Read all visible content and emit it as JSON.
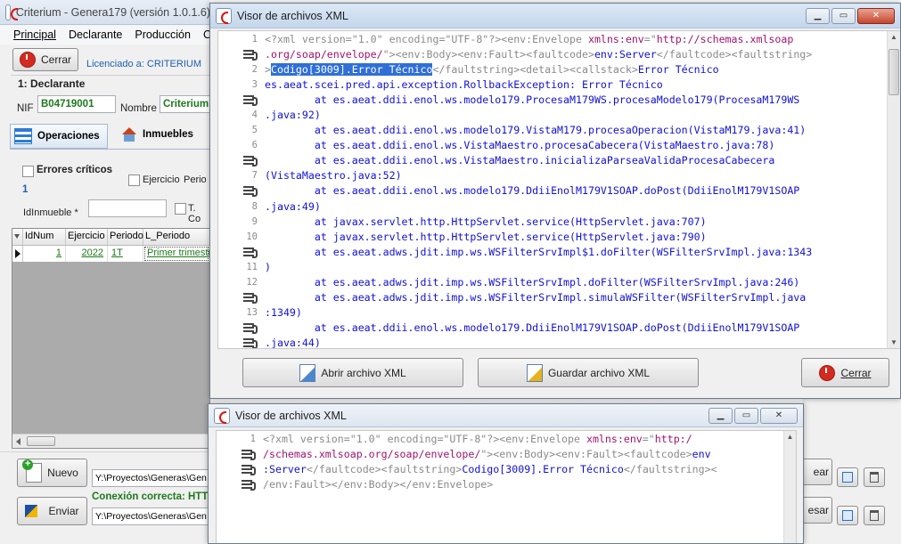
{
  "main_window": {
    "title": "Criterium - Genera179 (versión 1.0.1.6)",
    "menu": [
      "Principal",
      "Declarante",
      "Producción",
      "C"
    ],
    "cerrar_label": "Cerrar",
    "license": "Licenciado a: CRITERIUM",
    "section_title": "1: Declarante",
    "nif_label": "NIF",
    "nif_value": "B04719001",
    "nombre_label": "Nombre",
    "nombre_value": "Criterium",
    "tabs": [
      "Operaciones",
      "Inmuebles"
    ],
    "errores_label": "Errores críticos",
    "errores_count": "1",
    "ejercicio_label": "Ejercicio",
    "periodo_label": "Perio",
    "idinmueble_label": "IdInmueble *",
    "tc_label": "T. Co",
    "grid": {
      "headers": [
        "IdNum",
        "Ejercicio",
        "Periodo",
        "L_Periodo"
      ],
      "rows": [
        {
          "idnum": "1",
          "ejercicio": "2022",
          "periodo": "1T",
          "l_periodo": "Primer trimestr"
        }
      ]
    },
    "nuevo_label": "Nuevo",
    "path1": "Y:\\Proyectos\\Generas\\Gen",
    "conexion": "Conexión correcta: HTT",
    "enviar_label": "Enviar",
    "path2": "Y:\\Proyectos\\Generas\\Gen",
    "right_btn1": "ear",
    "right_btn2": "esar"
  },
  "xml_window_1": {
    "title": "Visor de archivos XML",
    "gutter": [
      "1",
      "",
      "2",
      "3",
      "",
      "4",
      "5",
      "6",
      "",
      "7",
      "",
      "8",
      "9",
      "10",
      "",
      "11",
      "12",
      "",
      "13",
      ""
    ],
    "lines": [
      [
        [
          "tg",
          "<?xml version=\"1.0\" encoding=\"UTF-8\"?><env:Envelope "
        ],
        [
          "kw",
          "xmlns:env"
        ],
        [
          "tg",
          "=\""
        ],
        [
          "kw",
          "http://schemas.xmlsoap"
        ]
      ],
      [
        [
          "kw",
          ".org/soap/envelope/"
        ],
        [
          "tg",
          "\"><env:Body><env:Fault><faultcode>"
        ],
        [
          "code",
          "env:Server"
        ],
        [
          "tg",
          "</faultcode><faultstring>"
        ]
      ],
      [
        [
          "tg",
          ">"
        ],
        [
          "sel",
          "Codigo[3009].Error Técnico"
        ],
        [
          "tg",
          "</faultstring><detail><callstack>"
        ],
        [
          "code",
          "Error Técnico"
        ]
      ],
      [
        [
          "code",
          "es.aeat.scei.pred.api.exception.RollbackException: Error Técnico"
        ]
      ],
      [
        [
          "code",
          "        at es.aeat.ddii.enol.ws.modelo179.ProcesaM179WS.procesaModelo179(ProcesaM179WS"
        ]
      ],
      [
        [
          "code",
          ".java:92)"
        ]
      ],
      [
        [
          "code",
          "        at es.aeat.ddii.enol.ws.modelo179.VistaM179.procesaOperacion(VistaM179.java:41)"
        ]
      ],
      [
        [
          "code",
          "        at es.aeat.ddii.enol.ws.VistaMaestro.procesaCabecera(VistaMaestro.java:78)"
        ]
      ],
      [
        [
          "code",
          "        at es.aeat.ddii.enol.ws.VistaMaestro.inicializaParseaValidaProcesaCabecera"
        ]
      ],
      [
        [
          "code",
          "(VistaMaestro.java:52)"
        ]
      ],
      [
        [
          "code",
          "        at es.aeat.ddii.enol.ws.modelo179.DdiiEnolM179V1SOAP.doPost(DdiiEnolM179V1SOAP"
        ]
      ],
      [
        [
          "code",
          ".java:49)"
        ]
      ],
      [
        [
          "code",
          "        at javax.servlet.http.HttpServlet.service(HttpServlet.java:707)"
        ]
      ],
      [
        [
          "code",
          "        at javax.servlet.http.HttpServlet.service(HttpServlet.java:790)"
        ]
      ],
      [
        [
          "code",
          "        at es.aeat.adws.jdit.imp.ws.WSFilterSrvImpl$1.doFilter(WSFilterSrvImpl.java:1343"
        ]
      ],
      [
        [
          "code",
          ")"
        ]
      ],
      [
        [
          "code",
          "        at es.aeat.adws.jdit.imp.ws.WSFilterSrvImpl.doFilter(WSFilterSrvImpl.java:246)"
        ]
      ],
      [
        [
          "code",
          "        at es.aeat.adws.jdit.imp.ws.WSFilterSrvImpl.simulaWSFilter(WSFilterSrvImpl.java"
        ]
      ],
      [
        [
          "code",
          ":1349)"
        ]
      ],
      [
        [
          "code",
          "        at es.aeat.ddii.enol.ws.modelo179.DdiiEnolM179V1SOAP.doPost(DdiiEnolM179V1SOAP"
        ]
      ],
      [
        [
          "code",
          ".java:44)"
        ]
      ]
    ],
    "abrir_label": "Abrir archivo XML",
    "guardar_label": "Guardar archivo XML",
    "cerrar_label": "Cerrar"
  },
  "xml_window_2": {
    "title": "Visor de archivos XML",
    "gutter": [
      "1",
      "",
      "",
      ""
    ],
    "lines": [
      [
        [
          "tg",
          "<?xml version=\"1.0\" encoding=\"UTF-8\"?><env:Envelope "
        ],
        [
          "kw",
          "xmlns:env"
        ],
        [
          "tg",
          "=\""
        ],
        [
          "kw",
          "http:/"
        ]
      ],
      [
        [
          "kw",
          "/schemas.xmlsoap.org/soap/envelope/"
        ],
        [
          "tg",
          "\"><env:Body><env:Fault><faultcode>"
        ],
        [
          "code",
          "env"
        ]
      ],
      [
        [
          "code",
          ":Server"
        ],
        [
          "tg",
          "</faultcode><faultstring>"
        ],
        [
          "code",
          "Codigo[3009].Error Técnico"
        ],
        [
          "tg",
          "</faultstring><"
        ]
      ],
      [
        [
          "tg",
          "/env:Fault></env:Body></env:Envelope>"
        ]
      ]
    ]
  }
}
